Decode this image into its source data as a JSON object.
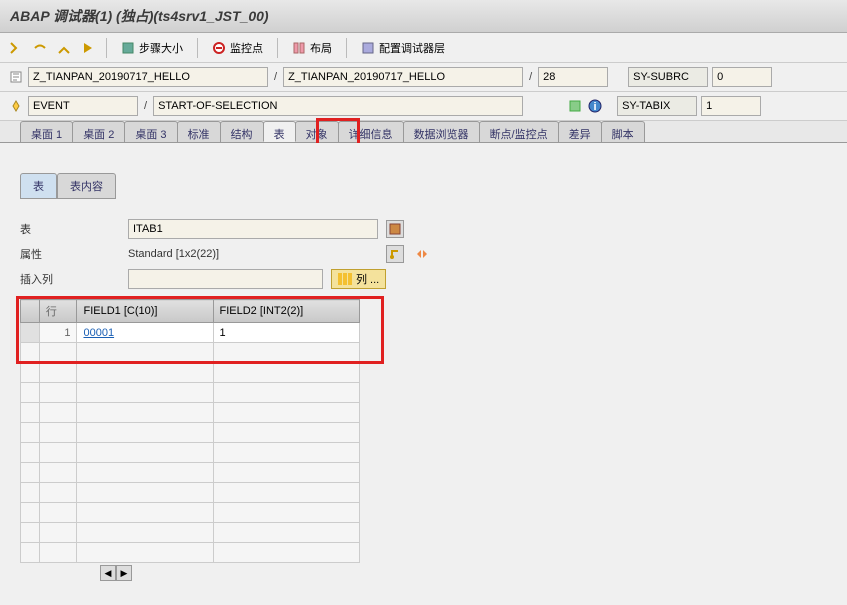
{
  "window": {
    "title": "ABAP 调试器(1) (独占)(ts4srv1_JST_00)"
  },
  "toolbar": {
    "step_size": "步骤大小",
    "watchpoint": "监控点",
    "layout": "布局",
    "debugger_layer": "配置调试器层"
  },
  "nav": {
    "program1": "Z_TIANPAN_20190717_HELLO",
    "program2": "Z_TIANPAN_20190717_HELLO",
    "line": "28",
    "sysubrc_label": "SY-SUBRC",
    "sysubrc_val": "0",
    "context1": "EVENT",
    "context2": "START-OF-SELECTION",
    "sytabix_label": "SY-TABIX",
    "sytabix_val": "1"
  },
  "tabs": {
    "t1": "桌面 1",
    "t2": "桌面 2",
    "t3": "桌面 3",
    "std": "标准",
    "struct": "结构",
    "table": "表",
    "obj": "对象",
    "detail": "详细信息",
    "browser": "数据浏览器",
    "break": "断点/监控点",
    "diff": "差异",
    "script": "脚本"
  },
  "subtabs": {
    "table": "表",
    "content": "表内容"
  },
  "form": {
    "table_label": "表",
    "table_val": "ITAB1",
    "attr_label": "属性",
    "attr_val": "Standard [1x2(22)]",
    "insert_label": "插入列",
    "insert_val": "",
    "col_btn": "列 ..."
  },
  "grid": {
    "h_row": "行",
    "h_f1": "FIELD1 [C(10)]",
    "h_f2": "FIELD2 [INT2(2)]",
    "rows": [
      {
        "n": "1",
        "f1": "00001",
        "f2": "1"
      }
    ]
  }
}
